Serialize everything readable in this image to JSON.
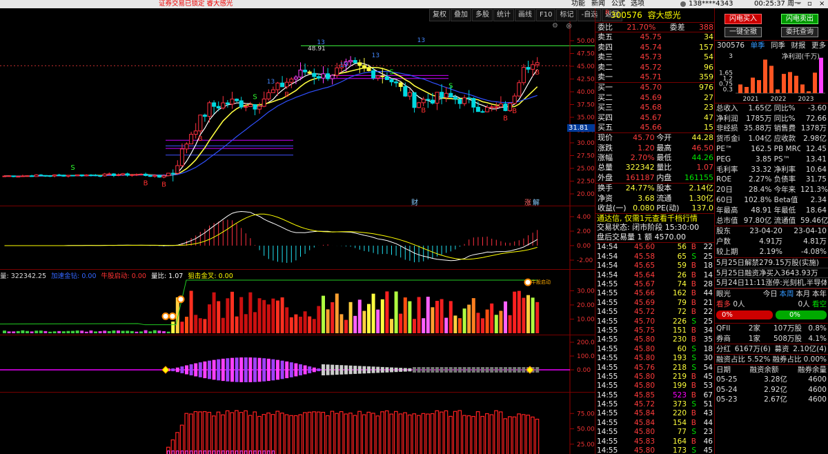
{
  "topbar": {
    "alert": "证券交易已锁定   睿大感光",
    "menu": [
      "功能",
      "新闻",
      "公式",
      "选项"
    ],
    "account": "138****4343",
    "clock": "00:25:37 周一"
  },
  "toolbar": [
    "复权",
    "叠加",
    "多股",
    "统计",
    "画线",
    "F10",
    "标记",
    "-自选",
    "返回"
  ],
  "kline": {
    "yaxis": [
      "50.00",
      "47.50",
      "45.00",
      "42.50",
      "40.00",
      "37.50",
      "35.00",
      "32.50",
      "30.00",
      "27.50",
      "25.00",
      "22.50",
      "20.00"
    ],
    "price_tag": "31.81",
    "high_label": "48.91",
    "markers": {
      "B": "B",
      "S": "S",
      "num": "13"
    },
    "events": [
      "财",
      "涨",
      "解"
    ]
  },
  "macd": {
    "yaxis": [
      "4.00",
      "2.00",
      "0.00",
      "-2.00"
    ]
  },
  "vol": {
    "legend": {
      "vol_label": "量: 322342.25",
      "a_label": "加速金钻: 0.00",
      "b_label": "牛股启动: 0.00",
      "ratio_label": "量比: 1.07",
      "c_label": "狙击金叉: 0.00"
    },
    "yaxis": [
      "30.00",
      "20.00",
      "10.00"
    ],
    "peak_label": "牛股启动"
  },
  "ind3": {
    "yaxis": [
      "200.0",
      "100.0",
      "0.00"
    ]
  },
  "ind4": {
    "yaxis": [
      "75.00",
      "50.00",
      "25.00"
    ]
  },
  "quote": {
    "header": {
      "code": "300576",
      "name": "容大感光",
      "flag": "R"
    },
    "weibi": {
      "l1": "委比",
      "v1": "21.70%",
      "l2": "委差",
      "v2": "388"
    },
    "asks": [
      [
        "卖五",
        "45.75",
        "34"
      ],
      [
        "卖四",
        "45.74",
        "157"
      ],
      [
        "卖三",
        "45.73",
        "54"
      ],
      [
        "卖二",
        "45.72",
        "96"
      ],
      [
        "卖一",
        "45.71",
        "359"
      ]
    ],
    "bids": [
      [
        "买一",
        "45.70",
        "976"
      ],
      [
        "买二",
        "45.69",
        "27"
      ],
      [
        "买三",
        "45.68",
        "23"
      ],
      [
        "买四",
        "45.67",
        "47"
      ],
      [
        "买五",
        "45.66",
        "15"
      ]
    ],
    "stats": [
      [
        "现价",
        "45.70",
        "今开",
        "44.28"
      ],
      [
        "涨跌",
        "1.20",
        "最高",
        "46.50"
      ],
      [
        "涨幅",
        "2.70%",
        "最低",
        "44.26"
      ],
      [
        "总量",
        "322342",
        "量比",
        "1.07"
      ],
      [
        "外盘",
        "161187",
        "内盘",
        "161155"
      ]
    ],
    "stats2": [
      [
        "换手",
        "24.77%",
        "股本",
        "2.14亿"
      ],
      [
        "净资",
        "3.68",
        "流通",
        "1.30亿"
      ],
      [
        "收益(一)",
        "0.080",
        "PE(动)",
        "137.0"
      ]
    ],
    "promo": "通达信, 仅需1元查看千档行情",
    "status": "交易状态: 闭市阶段 15:30:00",
    "after": "盘后交易量 1 额 4570.00",
    "ticks": [
      [
        "14:54",
        "45.60",
        "56",
        "B",
        "22"
      ],
      [
        "14:54",
        "45.58",
        "65",
        "S",
        "25"
      ],
      [
        "14:54",
        "45.65",
        "59",
        "B",
        "18"
      ],
      [
        "14:54",
        "45.64",
        "26",
        "B",
        "14"
      ],
      [
        "14:55",
        "45.67",
        "74",
        "B",
        "28"
      ],
      [
        "14:55",
        "45.66",
        "162",
        "B",
        "44"
      ],
      [
        "14:55",
        "45.69",
        "79",
        "B",
        "21"
      ],
      [
        "14:55",
        "45.72",
        "72",
        "B",
        "22"
      ],
      [
        "14:55",
        "45.70",
        "226",
        "S",
        "25"
      ],
      [
        "14:55",
        "45.75",
        "151",
        "B",
        "34"
      ],
      [
        "14:55",
        "45.80",
        "230",
        "B",
        "35"
      ],
      [
        "14:55",
        "45.80",
        "60",
        "S",
        "18"
      ],
      [
        "14:55",
        "45.80",
        "193",
        "S",
        "30"
      ],
      [
        "14:55",
        "45.76",
        "218",
        "S",
        "54"
      ],
      [
        "14:55",
        "45.80",
        "219",
        "B",
        "45"
      ],
      [
        "14:55",
        "45.80",
        "199",
        "B",
        "53"
      ],
      [
        "14:55",
        "45.85",
        "523",
        "B",
        "67"
      ],
      [
        "14:55",
        "45.72",
        "373",
        "S",
        "51"
      ],
      [
        "14:55",
        "45.84",
        "220",
        "B",
        "43"
      ],
      [
        "14:55",
        "45.84",
        "154",
        "B",
        "44"
      ],
      [
        "14:55",
        "45.80",
        "77",
        "S",
        "23"
      ],
      [
        "14:55",
        "45.83",
        "164",
        "B",
        "46"
      ],
      [
        "14:55",
        "45.80",
        "173",
        "S",
        "45"
      ]
    ]
  },
  "finance": {
    "btn_buy": "闪电买入",
    "btn_sell": "闪电卖出",
    "btn_all": "一键全撤",
    "btn_query": "委托查询",
    "tabs": {
      "code": "300576",
      "t1": "单季",
      "t2": "同季",
      "t3": "财报",
      "t4": "更多"
    },
    "chart": {
      "ylabels": [
        "3",
        "1.65",
        "1.2",
        "0.75",
        "0.3"
      ],
      "title": "净利润(千万)",
      "years": [
        "2021",
        "2022",
        "2023"
      ],
      "values": [
        0.7,
        0.5,
        1.25,
        1.05,
        2.7,
        2.2,
        0.3,
        1.55,
        1.7,
        1.4,
        0.7,
        0.15,
        1.65,
        2.85
      ]
    },
    "rows": [
      [
        "总收入",
        "1.65亿",
        "同比%",
        "-3.60"
      ],
      [
        "净利润",
        "1785万",
        "同比%",
        "72.66"
      ],
      [
        "非经损",
        "35.88万",
        "销售费",
        "1378万"
      ],
      [
        "货币金i",
        "1.04亿",
        "应收款",
        "2.98亿"
      ],
      [
        "PE™",
        "162.5",
        "PB MRQ",
        "12.45"
      ],
      [
        "PEG",
        "3.85",
        "PS™",
        "13.41"
      ],
      [
        "毛利率",
        "33.32",
        "净利率",
        "10.64"
      ],
      [
        "ROE",
        "2.27%",
        "负债率",
        "31.75"
      ],
      [
        "20日",
        "28.4%",
        "今年来",
        "121.3%"
      ],
      [
        "60日",
        "102.8%",
        "Beta值",
        "2.34"
      ],
      [
        "年最高",
        "48.91",
        "年最低",
        "18.64"
      ],
      [
        "总市值",
        "97.80亿",
        "流通值",
        "59.46亿"
      ]
    ],
    "holders": [
      [
        "股东",
        "23-04-20",
        "23-04-10"
      ],
      [
        "户数",
        "4.91万",
        "4.81万"
      ],
      [
        "较上期",
        "2.19%",
        "-4.08%"
      ]
    ],
    "news": [
      "5月25日解禁279.15万股(实施)",
      "5月25日融资净买入3643.93万",
      "5月24日11:11涨停:光刻机,半导体"
    ],
    "eye": {
      "title": "眼光",
      "tabs": [
        "今日",
        "本周",
        "本月",
        "本年"
      ],
      "bull": "看多",
      "bull_n": "0人",
      "bear": "0人",
      "bear_l": "看空",
      "p1": "0%",
      "p2": "0%"
    },
    "qfii": [
      [
        "QFII",
        "2家",
        "107万股",
        "0.8%"
      ],
      [
        "券商",
        "1家",
        "508万股",
        "4.1%"
      ]
    ],
    "fenhong": [
      "分红",
      "6167万(6)",
      "募资",
      "2.10亿(4)"
    ],
    "rz": [
      "融资占比",
      "5.52%",
      "融券占比",
      "0.00%"
    ],
    "rz_head": [
      "日期",
      "融资余额",
      "融券余量"
    ],
    "rz_rows": [
      [
        "05-25",
        "3.28亿",
        "4600"
      ],
      [
        "05-24",
        "2.92亿",
        "4600"
      ],
      [
        "05-23",
        "2.67亿",
        "4600"
      ]
    ]
  }
}
